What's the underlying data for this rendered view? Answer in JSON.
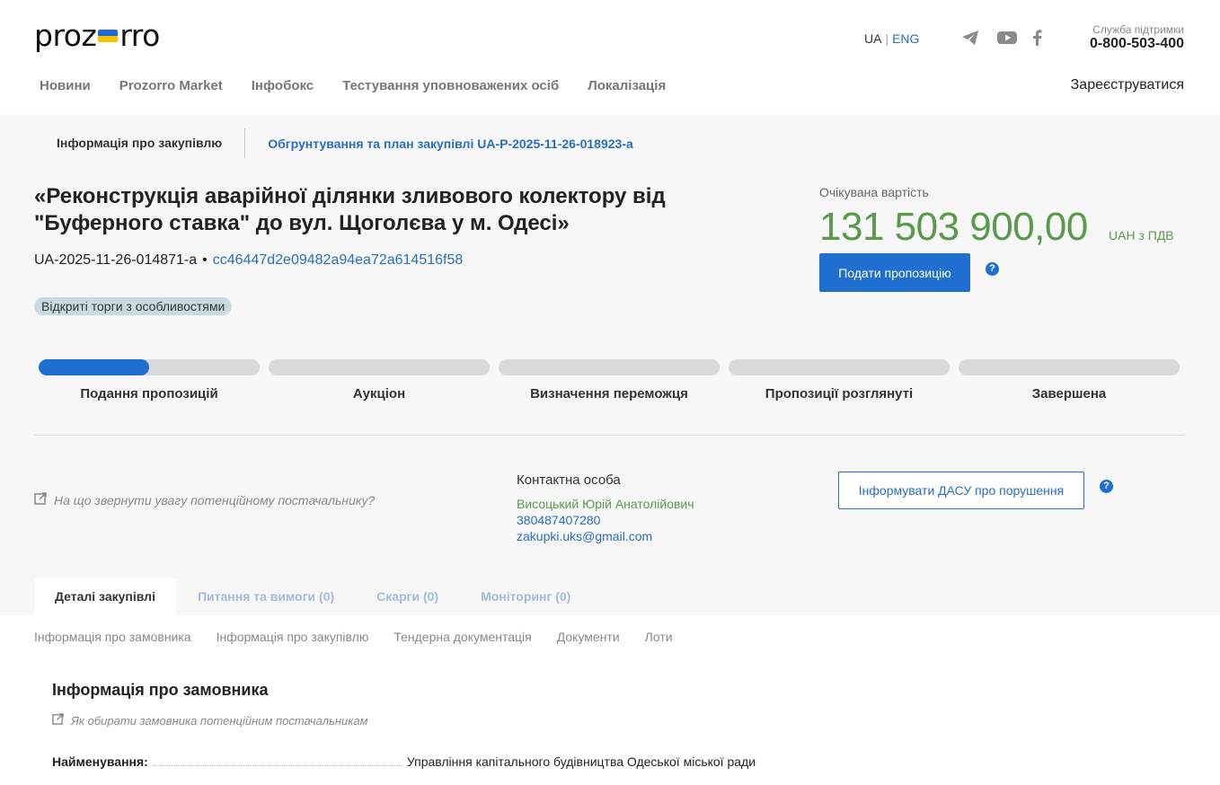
{
  "header": {
    "logo_left": "proz",
    "logo_right": "rro",
    "lang_ua": "UA",
    "lang_eng": "ENG",
    "support_label": "Служба підтримки",
    "support_phone": "0-800-503-400",
    "register": "Зареєструватися",
    "social_icons": [
      "telegram-icon",
      "youtube-icon",
      "facebook-icon"
    ]
  },
  "nav": [
    "Новини",
    "Prozorro Market",
    "Інфобокс",
    "Тестування уповноважених осіб",
    "Локалізація"
  ],
  "breadcrumbs": {
    "info": "Інформація про закупівлю",
    "plan": "Обгрунтування та план закупівлі UA-P-2025-11-26-018923-a"
  },
  "tender": {
    "title": "«Реконструкція аварійної ділянки зливового колектору від \"Буферного ставка\" до вул. Щоголєва у м. Одесі»",
    "id": "UA-2025-11-26-014871-a",
    "separator": "•",
    "hash": "cc46447d2e09482a94ea72a614516f58",
    "procedure": "Відкриті торги з особливостями",
    "expected_label": "Очікувана вартість",
    "amount": "131 503 900,00",
    "currency": "UAH з ПДВ",
    "submit_label": "Подати пропозицію",
    "help": "?"
  },
  "stages": [
    {
      "label": "Подання пропозицій",
      "progress": 0.5
    },
    {
      "label": "Аукціон",
      "progress": 0
    },
    {
      "label": "Визначення переможця",
      "progress": 0
    },
    {
      "label": "Пропозиції розглянуті",
      "progress": 0
    },
    {
      "label": "Завершена",
      "progress": 0
    }
  ],
  "hint": "На що звернути увагу потенційному постачальнику?",
  "contact": {
    "heading": "Контактна особа",
    "name": "Висоцький Юрій Анатолійович",
    "phone": "380487407280",
    "email": "zakupki.uks@gmail.com"
  },
  "dasu_button": "Інформувати ДАСУ про порушення",
  "tabs": [
    "Деталі закупівлі",
    "Питання та вимоги (0)",
    "Скарги (0)",
    "Моніторинг (0)"
  ],
  "subnav": [
    "Інформація про замовника",
    "Інформація про закупівлю",
    "Тендерна документація",
    "Документи",
    "Лоти"
  ],
  "customer": {
    "title": "Інформація про замовника",
    "hint": "Як обирати замовника потенційним постачальникам",
    "name_label": "Найменування:",
    "name_value": "Управління капітального будівництва Одеської міської ради"
  },
  "colors": {
    "accent": "#1f6fd1",
    "link": "#2a6fbd",
    "amount_green": "#5a9a4d",
    "background_gray": "#f7f7f7"
  }
}
